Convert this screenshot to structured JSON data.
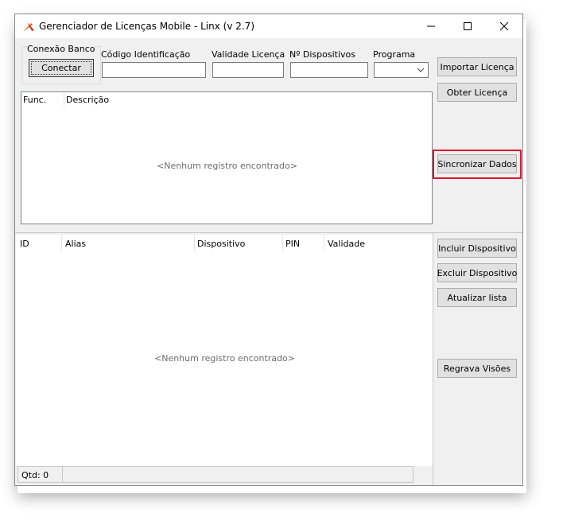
{
  "window": {
    "title": "Gerenciador de Licenças Mobile - Linx (v 2.7)"
  },
  "connection": {
    "group_label": "Conexão Banco",
    "connect_label": "Conectar"
  },
  "fields": {
    "codigo_label": "Código Identificação",
    "validade_label": "Validade Licença",
    "dispositivos_label": "Nº Dispositivos",
    "programa_label": "Programa"
  },
  "buttons": {
    "importar": "Importar Licença",
    "obter": "Obter Licença",
    "sincronizar": "Sincronizar Dados",
    "incluir": "Incluir Dispositivo",
    "excluir": "Excluir Dispositivo",
    "atualizar": "Atualizar lista",
    "regrava": "Regrava Visões"
  },
  "grid1": {
    "columns": [
      "Func.",
      "Descrição"
    ],
    "empty_text": "<Nenhum registro encontrado>"
  },
  "grid2": {
    "columns": [
      "ID",
      "Alias",
      "Dispositivo",
      "PIN",
      "Validade"
    ],
    "empty_text": "<Nenhum registro encontrado>"
  },
  "status": {
    "qtd": "Qtd: 0"
  },
  "icons": {
    "app": "linx-logo-icon",
    "minimize": "minimize-icon",
    "maximize": "maximize-icon",
    "close": "close-icon",
    "dropdown": "chevron-down-icon"
  },
  "colors": {
    "highlight": "#e0142d",
    "logo": "#e8641e"
  }
}
